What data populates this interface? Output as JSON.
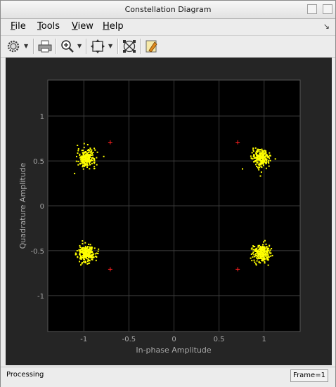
{
  "window": {
    "title": "Constellation Diagram"
  },
  "menu": {
    "items": [
      {
        "mnemonic": "F",
        "rest": "ile"
      },
      {
        "mnemonic": "T",
        "rest": "ools"
      },
      {
        "mnemonic": "V",
        "rest": "iew"
      },
      {
        "mnemonic": "H",
        "rest": "elp"
      }
    ]
  },
  "toolbar": {
    "icons": [
      "settings-icon",
      "print-icon",
      "zoom-in-icon",
      "autoscale-icon",
      "reference-constellation-icon",
      "highlight-icon"
    ]
  },
  "chart_data": {
    "type": "scatter",
    "xlabel": "In-phase Amplitude",
    "ylabel": "Quadrature Amplitude",
    "xlim": [
      -1.4,
      1.4
    ],
    "ylim": [
      -1.4,
      1.4
    ],
    "xticks": [
      "-1",
      "-0.5",
      "0",
      "0.5",
      "1"
    ],
    "yticks": [
      "1",
      "0.5",
      "0",
      "-0.5",
      "-1"
    ],
    "grid": true,
    "colors": {
      "background": "#000000",
      "figure": "#252525",
      "grid": "#3c3c3c",
      "text": "#a9a9a9",
      "points": "#ffff00",
      "reference": "#ff2020"
    },
    "clusters": [
      {
        "center": [
          -0.97,
          0.53
        ],
        "spread": 0.07,
        "count": 230
      },
      {
        "center": [
          0.97,
          0.53
        ],
        "spread": 0.07,
        "count": 230
      },
      {
        "center": [
          -0.97,
          -0.53
        ],
        "spread": 0.07,
        "count": 230
      },
      {
        "center": [
          0.97,
          -0.53
        ],
        "spread": 0.07,
        "count": 230
      }
    ],
    "reference_points": [
      [
        -0.707,
        0.707
      ],
      [
        0.707,
        0.707
      ],
      [
        -0.707,
        -0.707
      ],
      [
        0.707,
        -0.707
      ]
    ]
  },
  "status": {
    "text": "Processing",
    "frame": "Frame=1"
  }
}
